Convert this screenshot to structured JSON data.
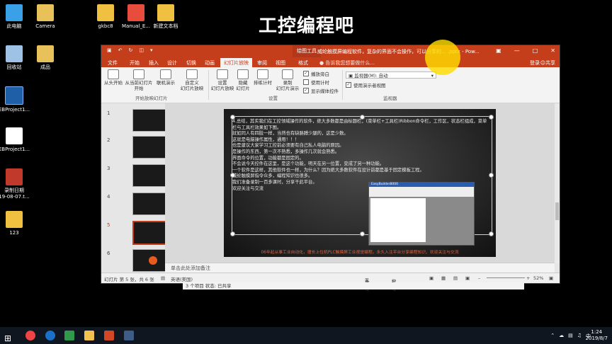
{
  "overlay_title": "工控编程吧",
  "desktop_icons": [
    {
      "label": "此电脑",
      "icon": "computer-icon",
      "color": "#3aa0e8"
    },
    {
      "label": "回收站",
      "icon": "recycle-bin-icon",
      "color": "#9ec2e6"
    },
    {
      "label": "EBProject1...",
      "icon": "ebproject-app-icon",
      "color": "#1f5fa8"
    },
    {
      "label": "EBProject1...",
      "icon": "document-icon",
      "color": "#ffffff"
    },
    {
      "label": "录制日期\n19-08-07.t...",
      "icon": "video-file-icon",
      "color": "#c0392b"
    },
    {
      "label": "123",
      "icon": "archive-icon",
      "color": "#f0c040"
    },
    {
      "label": "Camera",
      "icon": "folder-icon",
      "color": "#e8c15a"
    },
    {
      "label": "成品",
      "icon": "folder-icon",
      "color": "#e8c15a"
    },
    {
      "label": "gkbc8",
      "icon": "archive-icon",
      "color": "#f0c040"
    },
    {
      "label": "Manual_E...",
      "icon": "pdf-icon",
      "color": "#e74c3c"
    },
    {
      "label": "新建文本档",
      "icon": "archive-icon",
      "color": "#f0c040"
    }
  ],
  "window": {
    "context_tool": "绘图工具",
    "title": "威纶触摸屏编程软件，复杂的界面不会操作，可以分享的... .pptx - Pow...",
    "tabs": [
      "文件",
      "开始",
      "插入",
      "设计",
      "切换",
      "动画",
      "幻灯片放映",
      "审阅",
      "视图",
      "格式"
    ],
    "active_tab": "幻灯片放映",
    "tell_me": "告诉我您想要做什么...",
    "login": "登录",
    "share": "共享",
    "ribbon": {
      "buttons": [
        "从头开始",
        "从当前幻灯片\n开始",
        "联机演示",
        "自定义\n幻灯片放映",
        "设置\n幻灯片放映",
        "隐藏\n幻灯片",
        "排练计时",
        "录制\n幻灯片演示"
      ],
      "checkboxes": [
        {
          "label": "播放旁白",
          "checked": true
        },
        {
          "label": "使用计时",
          "checked": false
        },
        {
          "label": "显示媒体控件",
          "checked": true
        }
      ],
      "monitor_label": "监视器(M):",
      "monitor_value": "自动",
      "presenter_view": {
        "label": "使用演示者视图",
        "checked": true
      },
      "groups": [
        "开始放映幻灯片",
        "设置",
        "监视器"
      ]
    },
    "slide_numbers": [
      "1",
      "2",
      "3",
      "4",
      "5",
      "6"
    ],
    "selected_slide": "5",
    "slide_text": "4.总结，其实我们在工控领域操作的软件，绝大多数都是由标题栏，(菜单栏+工具栏)Ribbon命令栏，工作区，状态栏组成，菜单栏与工具栏效果如下图。\n就如同人有四肢一样，当然也有缺胳膊少腿的，这是少数。\n这就是电脑操作属性，通用！！！\n也是建议大家学习工控前必须要有自己私人电脑的原因。\n是操作的东西，第一次不熟悉，多操作几次就会熟悉。\n界面命令的位置，功能都是固定的。\n不会说今天控件在这里，是这个功能，明天在另一位置，变成了另一种功能。\n一个软件是这样，其他软件也一样，为什么？因为绝大多数软件在设计前都是基于固定模板工程。\n威纶触摸屏指令众多，编程知识也很多。\n我们准备录制一百多课时，分享干此平台。\n欢迎关注与交流",
    "slide_footer": "06年起从事工业自动化，擅长上位机PLC触摸屏工业视觉编程。永久入注平台分享编程知识，欢迎关注与交流",
    "inner_window_title": "EasyBuilder8000",
    "notes_placeholder": "单击此处添加备注",
    "status": {
      "slide_info": "幻灯片 第 5 张，共 6 张",
      "language": "英语(美国)",
      "notes": "备注",
      "comments": "批注",
      "zoom": "52%"
    }
  },
  "under_window_text": "3 个项目    状态: 已共享",
  "taskbar": {
    "time": "1:24",
    "date": "2019/8/7",
    "ime": "中"
  }
}
